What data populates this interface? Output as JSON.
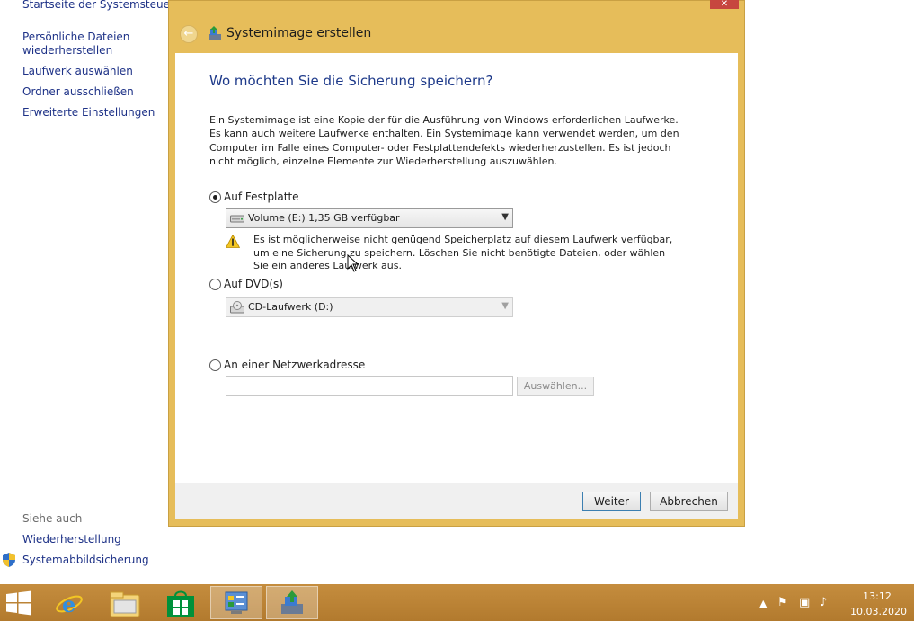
{
  "control_panel": {
    "home_link": "Startseite der Systemsteuerung",
    "links": [
      "Persönliche Dateien",
      "wiederherstellen",
      "Laufwerk auswählen",
      "Ordner ausschließen",
      "Erweiterte Einstellungen"
    ],
    "see_also": "Siehe auch",
    "see_also_links": [
      "Wiederherstellung",
      "Systemabbildsicherung"
    ]
  },
  "dialog": {
    "title": "Systemimage erstellen",
    "close_glyph": "✕",
    "heading": "Wo möchten Sie die Sicherung speichern?",
    "description": "Ein Systemimage ist eine Kopie der für die Ausführung von Windows erforderlichen Laufwerke. Es kann auch weitere Laufwerke enthalten. Ein Systemimage kann verwendet werden, um den Computer im Falle eines Computer- oder Festplattendefekts wiederherzustellen. Es ist jedoch nicht möglich, einzelne Elemente zur Wiederherstellung auszuwählen.",
    "option_hdd": {
      "label": "Auf Festplatte",
      "selected": true,
      "value": "Volume (E:)  1,35 GB verfügbar"
    },
    "warning": "Es ist möglicherweise nicht genügend Speicherplatz auf diesem Laufwerk verfügbar, um eine Sicherung zu speichern. Löschen Sie nicht benötigte Dateien, oder wählen Sie ein anderes Laufwerk aus.",
    "option_dvd": {
      "label": "Auf DVD(s)",
      "selected": false,
      "value": "CD-Laufwerk (D:)"
    },
    "option_network": {
      "label": "An einer Netzwerkadresse",
      "selected": false,
      "value": "",
      "browse": "Auswählen..."
    },
    "next": "Weiter",
    "cancel": "Abbrechen"
  },
  "taskbar": {
    "time": "13:12",
    "date": "10.03.2020"
  },
  "colors": {
    "title_bar": "#e6bd5a",
    "taskbar": "#b98134",
    "heading": "#1e3a8a",
    "link": "#1e3287"
  }
}
